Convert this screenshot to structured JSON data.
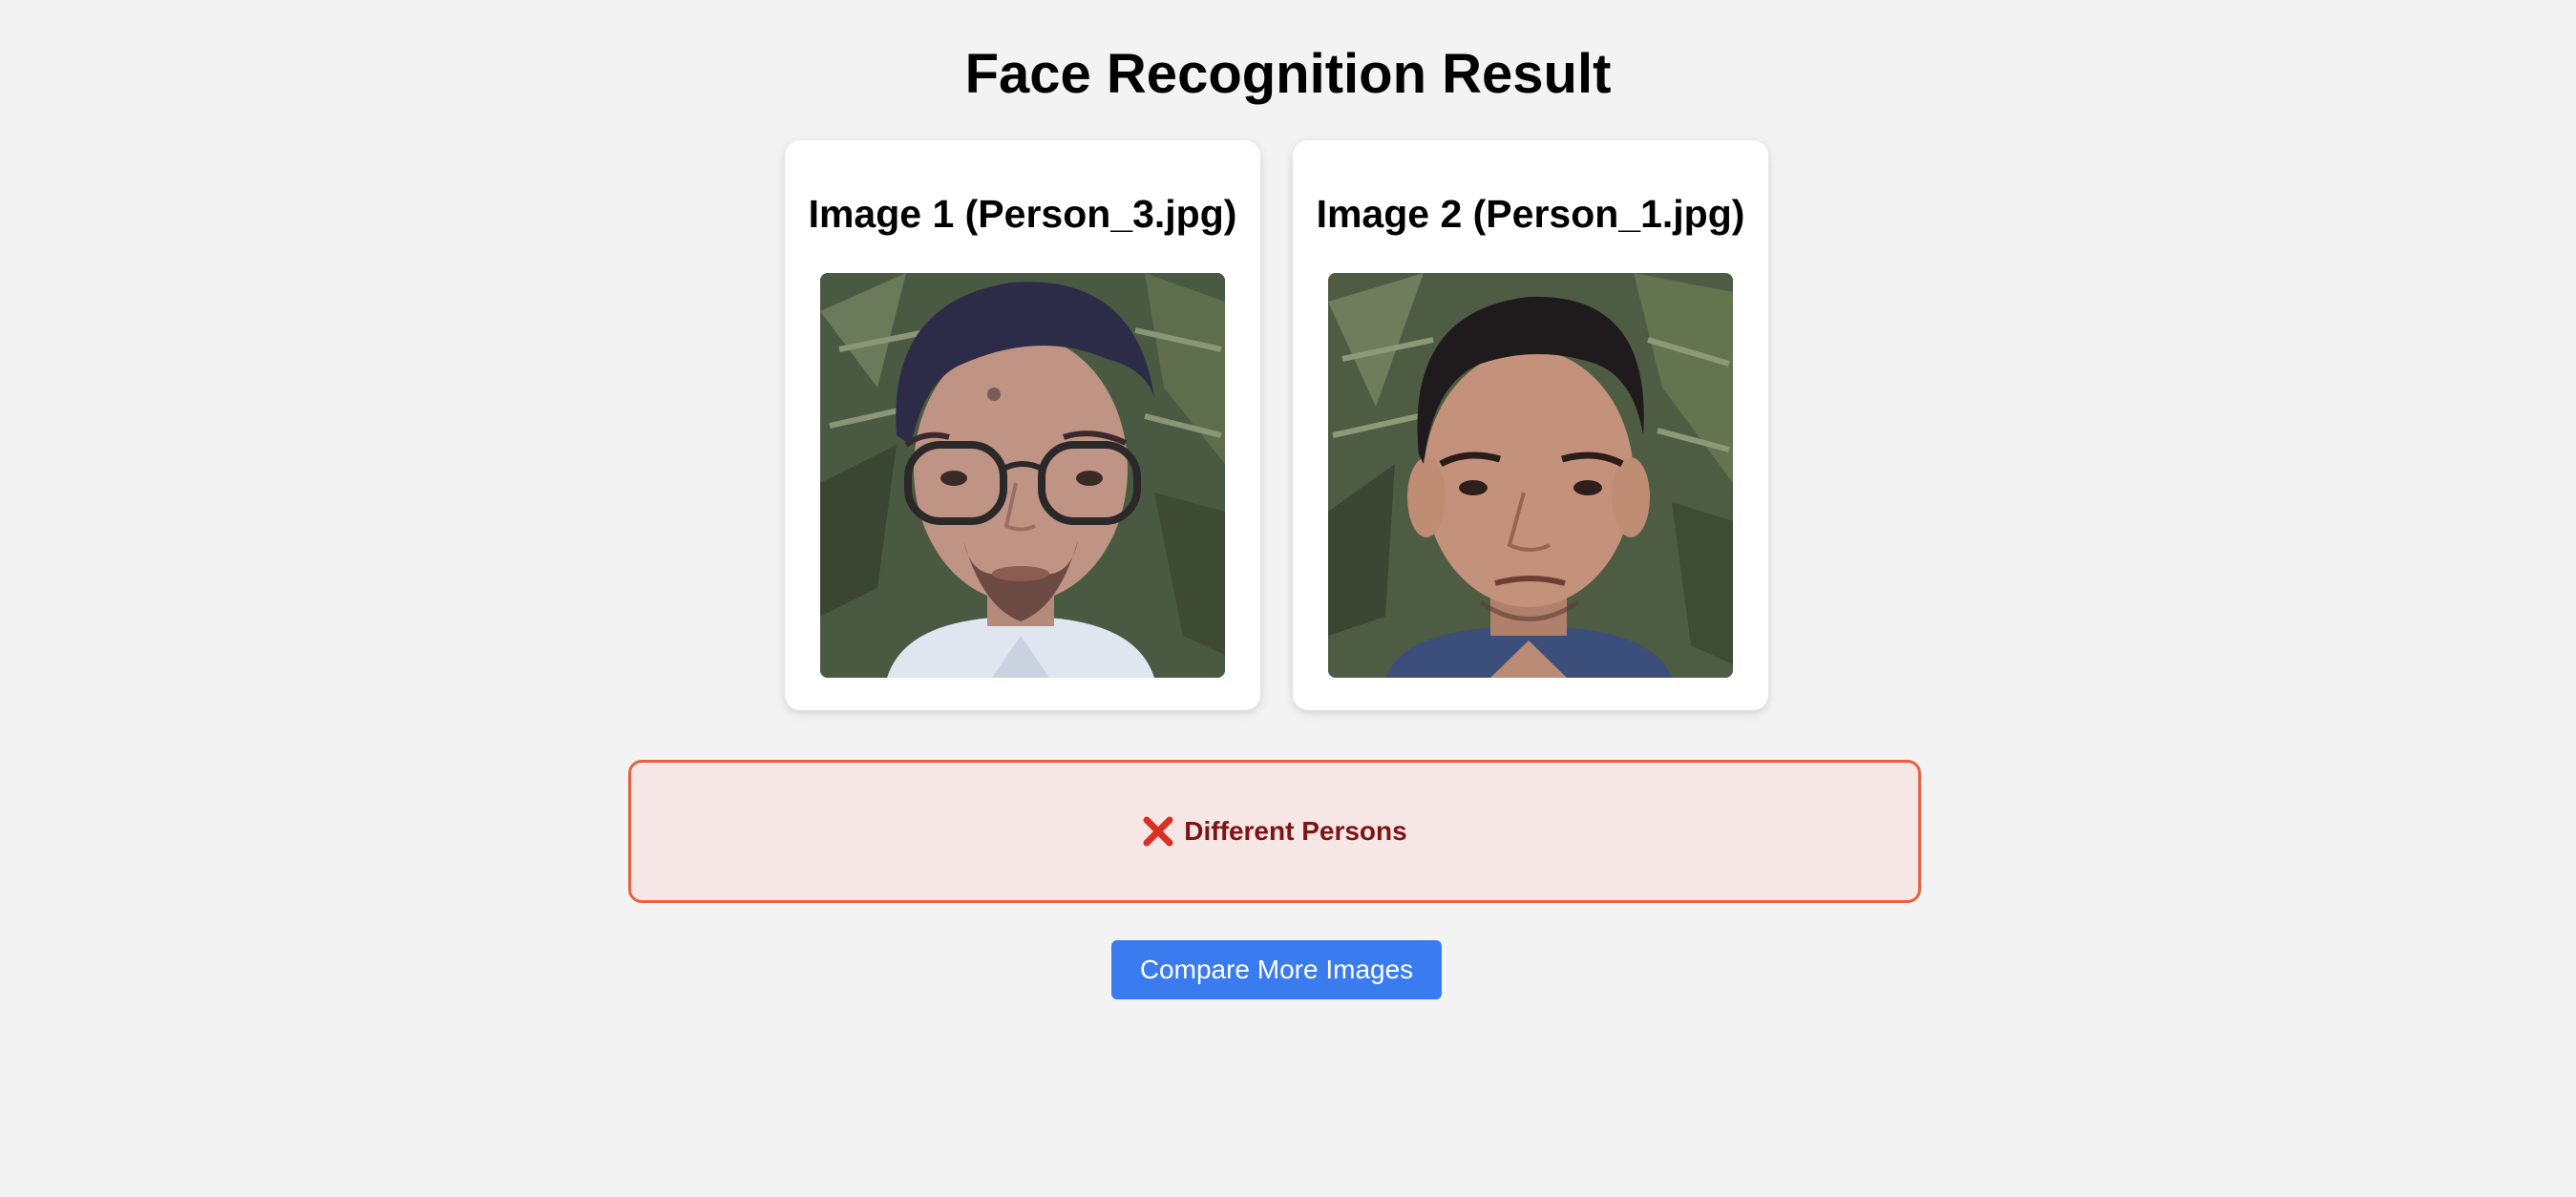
{
  "page": {
    "title": "Face Recognition Result"
  },
  "images": [
    {
      "label": "Image 1 (Person_3.jpg)",
      "photo_alt": "Person_3.jpg"
    },
    {
      "label": "Image 2 (Person_1.jpg)",
      "photo_alt": "Person_1.jpg"
    }
  ],
  "result": {
    "icon": "cross-mark-icon",
    "text": "Different Persons",
    "status": "mismatch",
    "colors": {
      "background": "#f6e6e6",
      "border": "#e8623f",
      "text": "#7e1414",
      "icon": "#d93025"
    }
  },
  "actions": {
    "compare_label": "Compare More Images",
    "button_color": "#3a7bf0"
  }
}
